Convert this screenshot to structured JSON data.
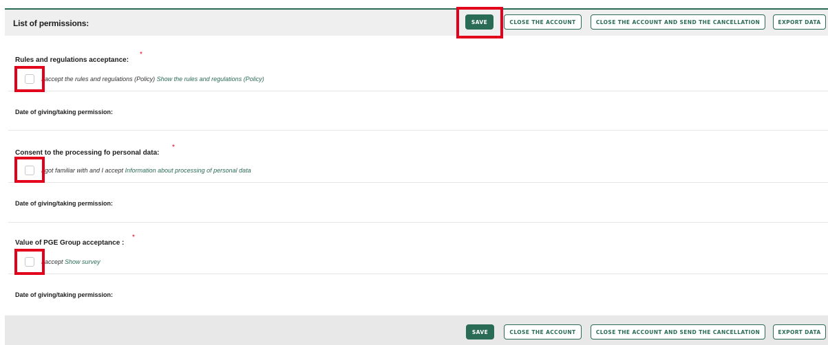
{
  "header": {
    "title": "List of permissions:"
  },
  "buttons": {
    "save": "SAVE",
    "close_account": "CLOSE THE ACCOUNT",
    "close_account_send": "CLOSE THE ACCOUNT AND SEND THE CANCELLATION",
    "export_data": "EXPORT DATA"
  },
  "permissions": [
    {
      "title": "Rules and regulations acceptance:",
      "required_mark": "*",
      "checkbox_text": "I accept the rules and regulations (Policy)",
      "link_text": "Show the rules and regulations (Policy)",
      "date_label": "Date of giving/taking permission:"
    },
    {
      "title": "Consent to the processing fo personal data:",
      "required_mark": "*",
      "checkbox_text": "I got familiar with and I accept",
      "link_text": "Information about processing of personal data",
      "date_label": "Date of giving/taking permission:"
    },
    {
      "title": "Value of PGE Group acceptance :",
      "required_mark": "*",
      "checkbox_text": "I accept",
      "link_text": "Show survey",
      "date_label": "Date of giving/taking permission:"
    }
  ],
  "colors": {
    "accent": "#2a6b56",
    "highlight": "#e3001b"
  }
}
